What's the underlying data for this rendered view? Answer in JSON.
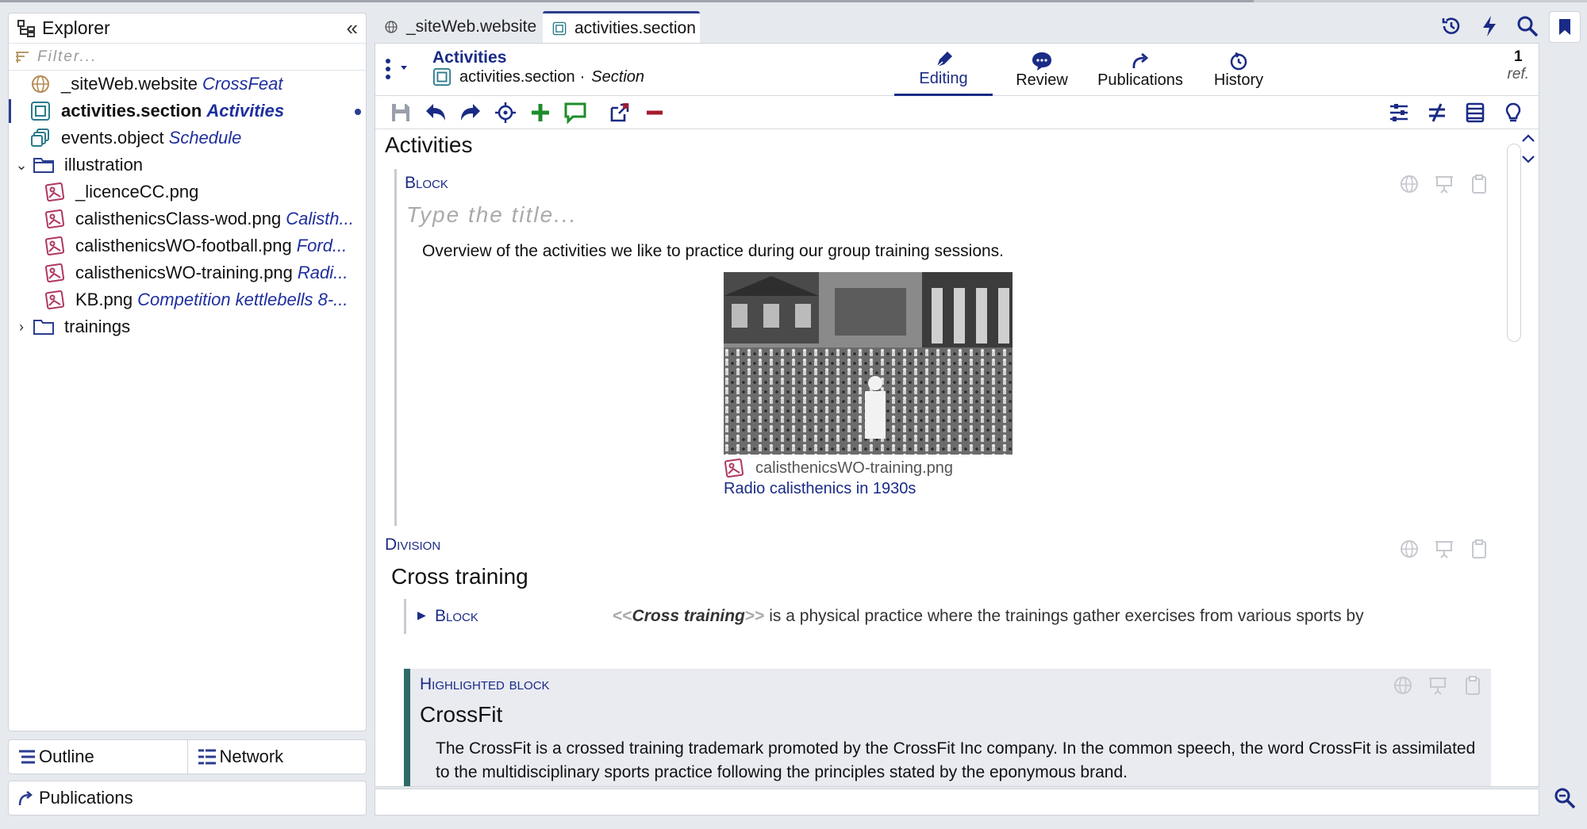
{
  "explorer": {
    "title": "Explorer",
    "filter_placeholder": "Filter...",
    "items": [
      {
        "name": "_siteWeb.website",
        "sub": "CrossFeat"
      },
      {
        "name": "activities.section",
        "sub": "Activities"
      },
      {
        "name": "events.object",
        "sub": "Schedule"
      },
      {
        "name": "illustration",
        "sub": ""
      },
      {
        "name": "_licenceCC.png",
        "sub": ""
      },
      {
        "name": "calisthenicsClass-wod.png",
        "sub": "Calisth..."
      },
      {
        "name": "calisthenicsWO-football.png",
        "sub": "Ford..."
      },
      {
        "name": "calisthenicsWO-training.png",
        "sub": "Radi..."
      },
      {
        "name": "KB.png",
        "sub": "Competition kettlebells 8-..."
      },
      {
        "name": "trainings",
        "sub": ""
      }
    ]
  },
  "bottom_tabs": {
    "outline": "Outline",
    "network": "Network",
    "publications": "Publications"
  },
  "tabs": {
    "tab1": "_siteWeb.website",
    "tab2": "activities.section"
  },
  "header": {
    "title": "Activities",
    "file": "activities.section",
    "type": "Section",
    "ref_count": "1",
    "ref_label": "ref."
  },
  "modes": {
    "editing": "Editing",
    "review": "Review",
    "publications": "Publications",
    "history": "History"
  },
  "content": {
    "doc_title": "Activities",
    "block_label": "Block",
    "title_placeholder": "Type the title...",
    "overview": "Overview of the activities we like to practice during our group training sessions.",
    "figure_file": "calisthenicsWO-training.png",
    "figure_caption": "Radio calisthenics in 1930s",
    "division_label": "Division",
    "division_title": "Cross training",
    "sub_block_label": "Block",
    "sub_open": "<<",
    "sub_term": "Cross training",
    "sub_close": ">>",
    "sub_text": " is a physical practice where the trainings gather exercises from various sports by",
    "hl_label": "Highlighted block",
    "hl_title": "CrossFit",
    "hl_text": "The CrossFit is a crossed training trademark promoted by the CrossFit Inc company. In the common speech, the word CrossFit is assimilated to the multidisciplinary sports practice following the principles stated by the eponymous brand."
  },
  "colors": {
    "accent": "#1a2b86",
    "highlight_bar": "#2e6a68",
    "add_green": "#1e8c2a",
    "remove_red": "#a51a2e"
  }
}
